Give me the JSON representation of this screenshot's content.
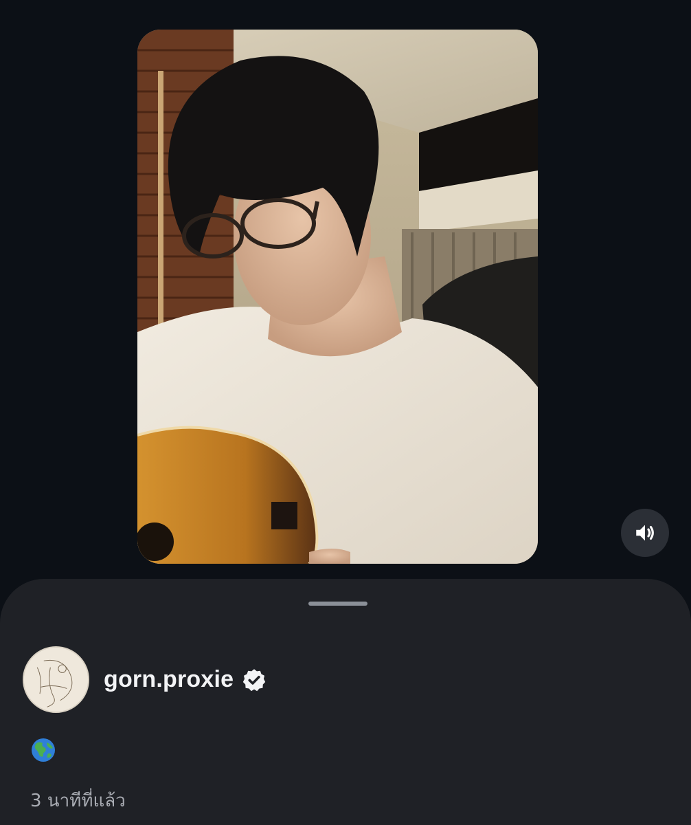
{
  "story": {
    "media_type": "video",
    "volume_icon": "volume-icon"
  },
  "author": {
    "username": "gorn.proxie",
    "verified": true,
    "verified_icon": "verified-badge-icon"
  },
  "caption": {
    "emoji": "🌎"
  },
  "timestamp": "3 นาทีที่แล้ว",
  "colors": {
    "background": "#0c1016",
    "sheet": "#1f2126",
    "text": "#f3f4f6",
    "muted_text": "#a8abb2"
  }
}
